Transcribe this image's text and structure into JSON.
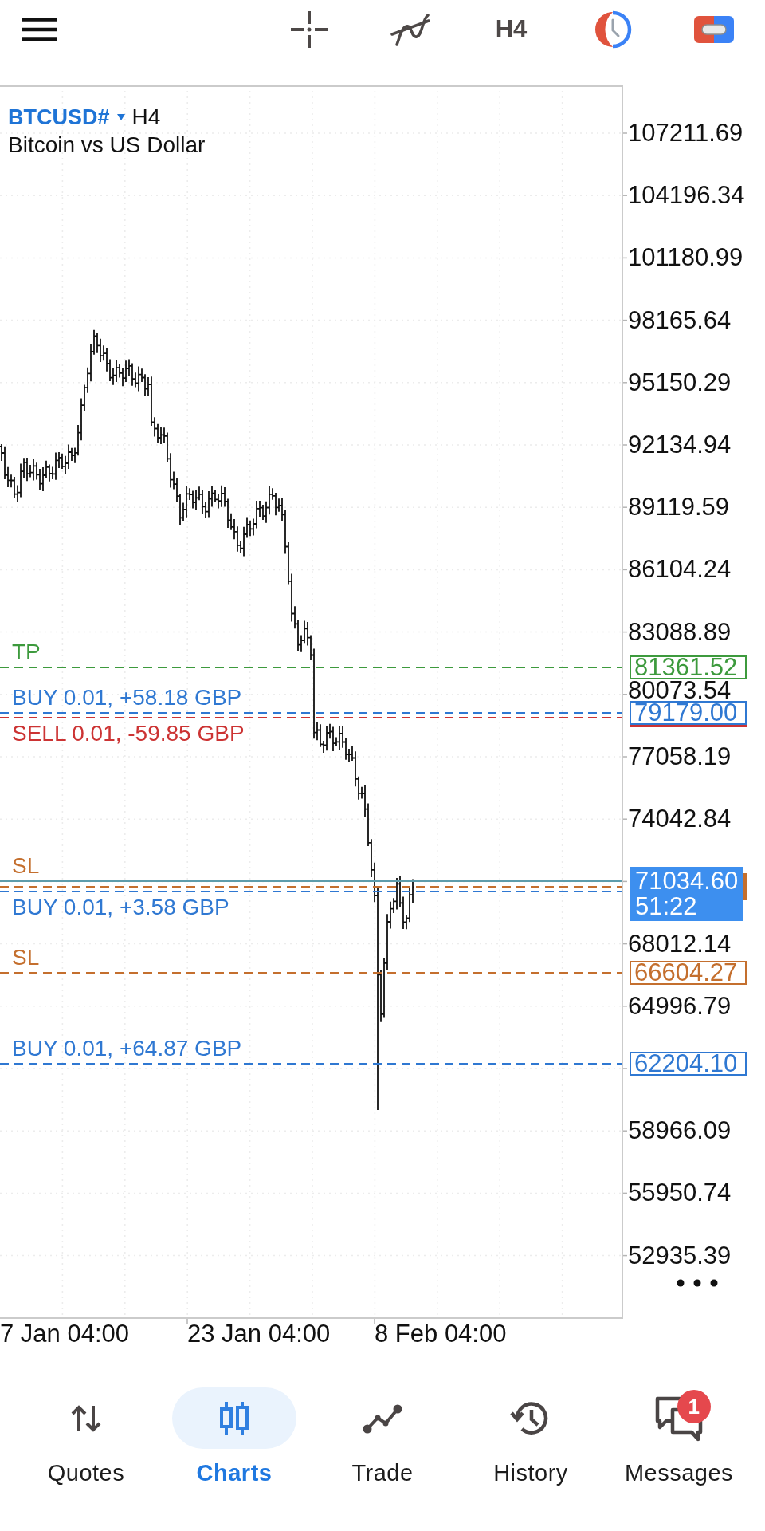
{
  "toolbar": {
    "timeframe": "H4"
  },
  "chart": {
    "symbol": "BTCUSD#",
    "timeframe": "H4",
    "description": "Bitcoin vs US Dollar",
    "price_axis": [
      "107211.69",
      "104196.34",
      "101180.99",
      "98165.64",
      "95150.29",
      "92134.94",
      "89119.59",
      "86104.24",
      "83088.89",
      "80073.54",
      "77058.19",
      "74042.84",
      "68012.14",
      "64996.79",
      "58966.09",
      "55950.74",
      "52935.39"
    ],
    "time_axis": [
      "7 Jan 04:00",
      "23 Jan 04:00",
      "8 Feb 04:00"
    ],
    "levels": [
      {
        "kind": "outline",
        "price": "81361.52",
        "color": "#3d9a3d",
        "lines": [
          {
            "kind": "dashed",
            "label": "TP",
            "color": "#3d9a3d"
          }
        ]
      },
      {
        "kind": "outline",
        "price": "79179.00",
        "color": "#2f78d2",
        "lines": [
          {
            "kind": "dashed",
            "label": "BUY 0.01, +58.18 GBP",
            "color": "#2f78d2"
          },
          {
            "kind": "dashed",
            "label": "SELL 0.01, -59.85 GBP",
            "color": "#cc3333"
          }
        ]
      },
      {
        "kind": "filled",
        "price": "71034.60",
        "countdown": "51:22",
        "color": "#3d8fef",
        "lines": [
          {
            "kind": "solid",
            "color": "#5d9cab"
          },
          {
            "kind": "dashed",
            "label": "SL",
            "color": "#c46f2e"
          },
          {
            "kind": "dashed",
            "label": "BUY 0.01, +3.58 GBP",
            "color": "#2f78d2"
          }
        ]
      },
      {
        "kind": "outline",
        "price": "66604.27",
        "color": "#c46f2e",
        "lines": [
          {
            "kind": "dashed",
            "label": "SL",
            "color": "#c46f2e"
          }
        ]
      },
      {
        "kind": "outline",
        "price": "62204.10",
        "color": "#2f78d2",
        "lines": [
          {
            "kind": "dashed",
            "label": "BUY 0.01, +64.87 GBP",
            "color": "#2f78d2"
          }
        ]
      }
    ]
  },
  "bottom_nav": [
    {
      "label": "Quotes",
      "selected": false
    },
    {
      "label": "Charts",
      "selected": true
    },
    {
      "label": "Trade",
      "selected": false
    },
    {
      "label": "History",
      "selected": false
    },
    {
      "label": "Messages",
      "selected": false,
      "badge": "1"
    }
  ]
}
